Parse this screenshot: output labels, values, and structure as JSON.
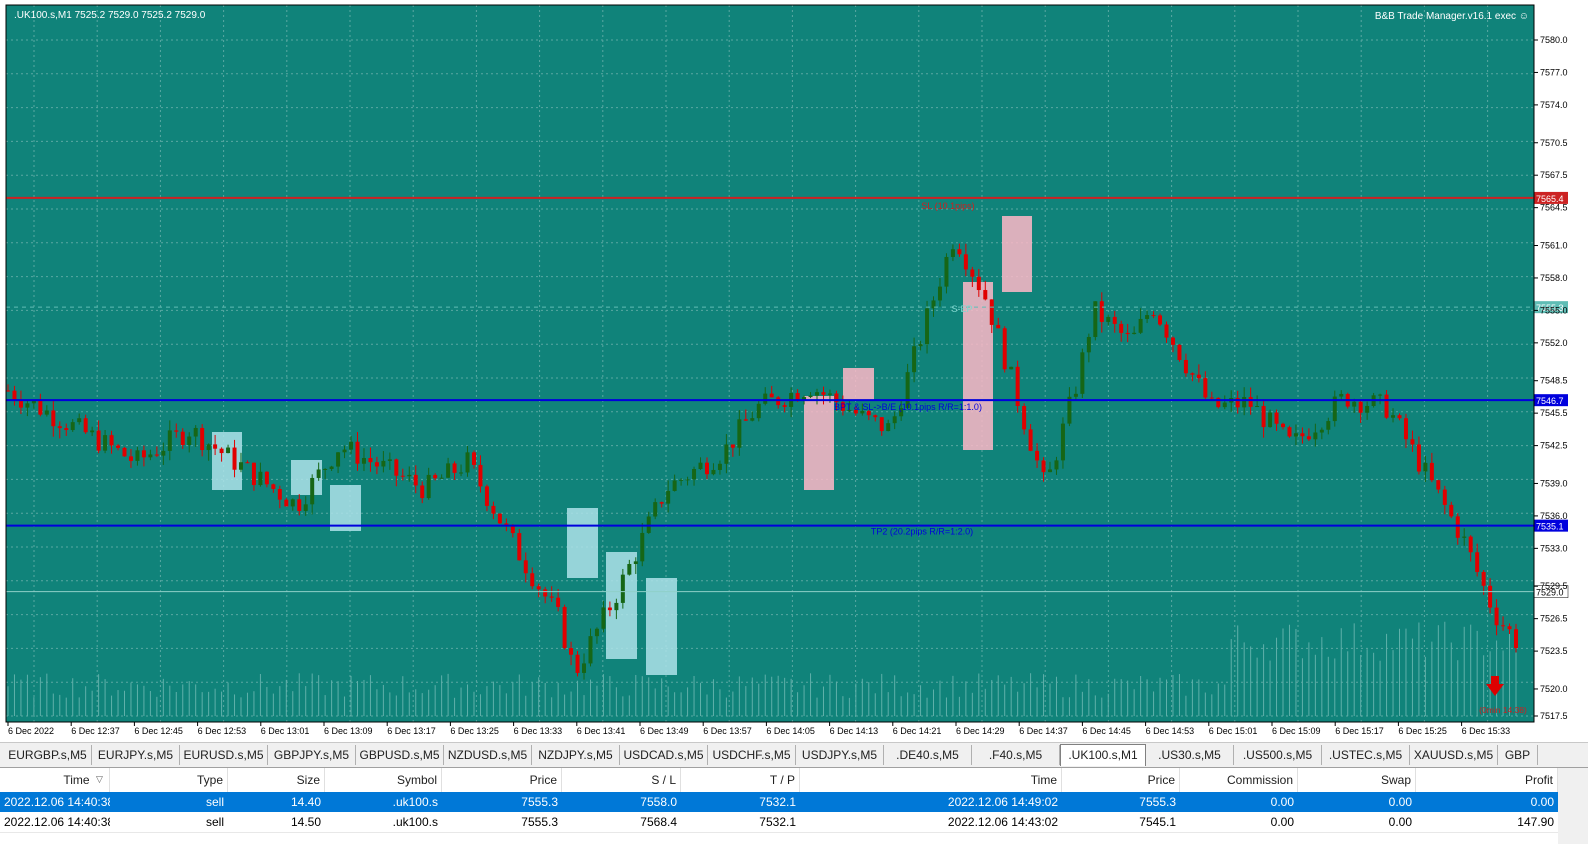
{
  "chart": {
    "symbol_info": ".UK100.s,M1  7525.2 7529.0 7525.2 7529.0",
    "ea_label": "B&B Trade Manager.v16.1 exec ☺",
    "time_labels": [
      "6 Dec 2022",
      "6 Dec 12:37",
      "6 Dec 12:45",
      "6 Dec 12:53",
      "6 Dec 13:01",
      "6 Dec 13:09",
      "6 Dec 13:17",
      "6 Dec 13:25",
      "6 Dec 13:33",
      "6 Dec 13:41",
      "6 Dec 13:49",
      "6 Dec 13:57",
      "6 Dec 14:05",
      "6 Dec 14:13",
      "6 Dec 14:21",
      "6 Dec 14:29",
      "6 Dec 14:37",
      "6 Dec 14:45",
      "6 Dec 14:53",
      "6 Dec 15:01",
      "6 Dec 15:09",
      "6 Dec 15:17",
      "6 Dec 15:25",
      "6 Dec 15:33"
    ],
    "price_labels": [
      "7580.0",
      "7577.0",
      "7574.0",
      "7570.5",
      "7567.5",
      "7564.5",
      "7561.0",
      "7558.0",
      "7555.0",
      "7552.0",
      "7548.5",
      "7545.5",
      "7542.5",
      "7539.0",
      "7536.0",
      "7533.0",
      "7529.5",
      "7526.5",
      "7523.5",
      "7520.0",
      "7517.5"
    ],
    "sl_line": {
      "price": 7565.4,
      "label": "SL (10.1pips)",
      "tag": "7565.4"
    },
    "bep_line": {
      "price": 7546.7,
      "label": "BPT & SL->B/E (10.1pips R/R=1:1.0)",
      "tag": "7546.7"
    },
    "tp_line": {
      "price": 7535.1,
      "label": "TP2 (20.2pips R/R=1:2.0)",
      "tag": "7535.1"
    },
    "entry_line": {
      "price": 7555.3,
      "label": "S-EP",
      "tag": "7555.3"
    },
    "current_price": {
      "price": 7529.0,
      "tag": "7529.0"
    },
    "countdown": "(0min 14:38)",
    "colors": {
      "bg": "#10837a",
      "grid": "#5aa8a2",
      "bull": "#166616",
      "bear": "#e00000",
      "sl": "#cc2222",
      "level": "#0000dd",
      "bullzone": "#aee3ea",
      "bearzone": "#ffb8c8"
    }
  },
  "tabs": [
    "EURGBP.s,M5",
    "EURJPY.s,M5",
    "EURUSD.s,M5",
    "GBPJPY.s,M5",
    "GBPUSD.s,M5",
    "NZDUSD.s,M5",
    "NZDJPY.s,M5",
    "USDCAD.s,M5",
    "USDCHF.s,M5",
    "USDJPY.s,M5",
    ".DE40.s,M5",
    ".F40.s,M5",
    ".UK100.s,M1",
    ".US30.s,M5",
    ".US500.s,M5",
    ".USTEC.s,M5",
    "XAUUSD.s,M5",
    "GBP"
  ],
  "active_tab": 12,
  "table": {
    "headers": [
      "Time",
      "Type",
      "Size",
      "Symbol",
      "Price",
      "S / L",
      "T / P",
      "Time",
      "Price",
      "Commission",
      "Swap",
      "Profit"
    ],
    "rows": [
      [
        "2022.12.06 14:40:38",
        "sell",
        "14.40",
        ".uk100.s",
        "7555.3",
        "7558.0",
        "7532.1",
        "2022.12.06 14:49:02",
        "7555.3",
        "0.00",
        "0.00",
        "0.00"
      ],
      [
        "2022.12.06 14:40:38",
        "sell",
        "14.50",
        ".uk100.s",
        "7555.3",
        "7568.4",
        "7532.1",
        "2022.12.06 14:43:02",
        "7545.1",
        "0.00",
        "0.00",
        "147.90"
      ]
    ]
  }
}
